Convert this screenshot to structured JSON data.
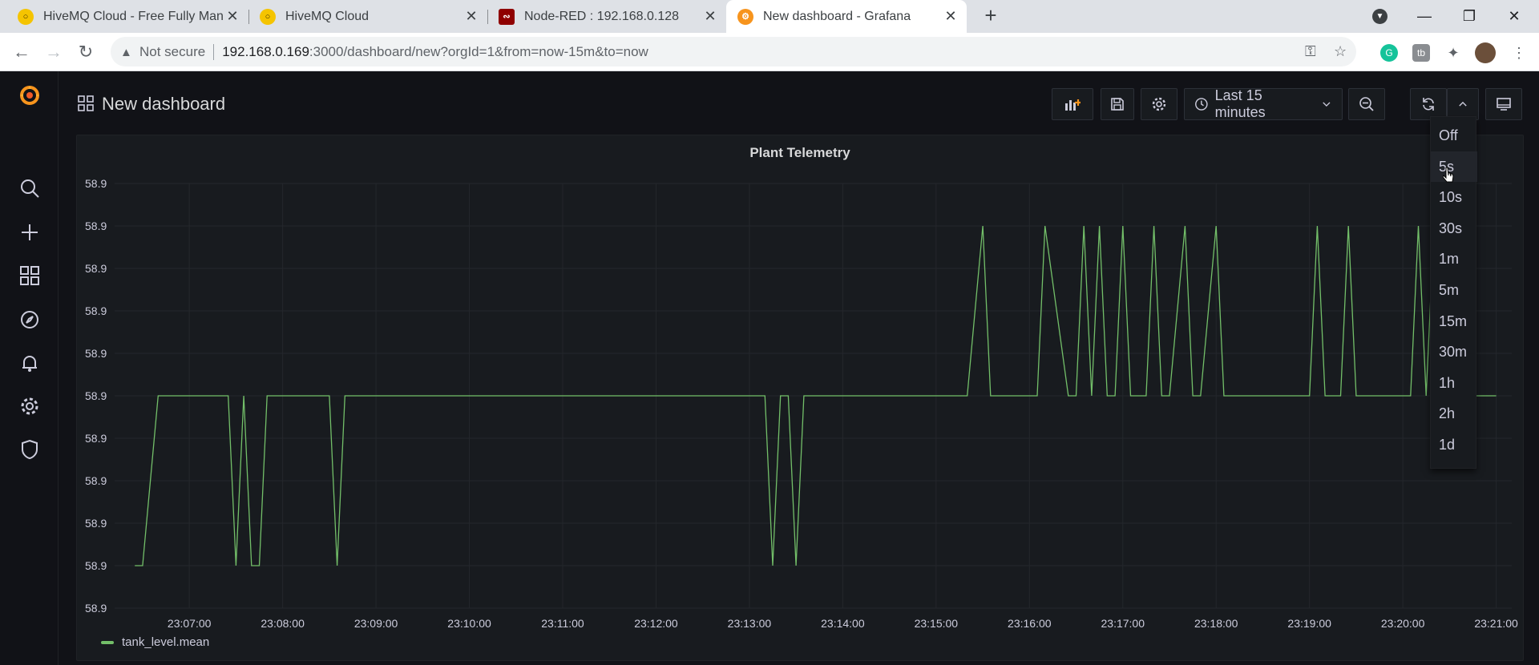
{
  "browser": {
    "tabs": [
      {
        "title": "HiveMQ Cloud - Free Fully Mana",
        "icon": "hivemq-icon"
      },
      {
        "title": "HiveMQ Cloud",
        "icon": "hivemq-icon"
      },
      {
        "title": "Node-RED : 192.168.0.128",
        "icon": "node-red-icon"
      },
      {
        "title": "New dashboard - Grafana",
        "icon": "grafana-icon",
        "active": true
      }
    ],
    "address": {
      "security_label": "Not secure",
      "host": "192.168.0.169",
      "path": ":3000/dashboard/new?orgId=1&from=now-15m&to=now"
    }
  },
  "grafana": {
    "dashboard_title": "New dashboard",
    "time_range_label": "Last 15 minutes",
    "panel": {
      "title": "Plant Telemetry",
      "legend_label": "tank_level.mean"
    },
    "refresh_options": [
      "Off",
      "5s",
      "10s",
      "30s",
      "1m",
      "5m",
      "15m",
      "30m",
      "1h",
      "2h",
      "1d"
    ],
    "hovered_refresh_option": "5s"
  },
  "colors": {
    "series": "#73bf69",
    "background": "#111217",
    "panel": "#181b1f"
  },
  "chart_data": {
    "type": "line",
    "title": "Plant Telemetry",
    "xlabel": "",
    "ylabel": "",
    "y_tick_labels": [
      "58.9",
      "58.9",
      "58.9",
      "58.9",
      "58.9",
      "58.9",
      "58.9",
      "58.9",
      "58.9",
      "58.9",
      "58.9"
    ],
    "x_tick_labels": [
      "23:07:00",
      "23:08:00",
      "23:09:00",
      "23:10:00",
      "23:11:00",
      "23:12:00",
      "23:13:00",
      "23:14:00",
      "23:15:00",
      "23:16:00",
      "23:17:00",
      "23:18:00",
      "23:19:00",
      "23:20:00",
      "23:21:00"
    ],
    "grid": true,
    "legend_placement": "bottom-left",
    "series": [
      {
        "name": "tank_level.mean",
        "level_note": "values shown relative to tick rows: all ticks read 58.9",
        "x": [
          "23:06:25",
          "23:06:30",
          "23:06:40",
          "23:07:25",
          "23:07:30",
          "23:07:35",
          "23:07:40",
          "23:07:45",
          "23:07:50",
          "23:07:55",
          "23:08:30",
          "23:08:35",
          "23:08:40",
          "23:13:10",
          "23:13:15",
          "23:13:20",
          "23:13:25",
          "23:13:30",
          "23:13:35",
          "23:13:40",
          "23:15:20",
          "23:15:30",
          "23:15:35",
          "23:16:05",
          "23:16:10",
          "23:16:25",
          "23:16:30",
          "23:16:35",
          "23:16:40",
          "23:16:45",
          "23:16:50",
          "23:16:55",
          "23:17:00",
          "23:17:05",
          "23:17:15",
          "23:17:20",
          "23:17:25",
          "23:17:30",
          "23:17:40",
          "23:17:45",
          "23:17:50",
          "23:18:00",
          "23:18:05",
          "23:18:10",
          "23:19:00",
          "23:19:05",
          "23:19:10",
          "23:19:20",
          "23:19:25",
          "23:19:30",
          "23:20:05",
          "23:20:10",
          "23:20:15",
          "23:20:20",
          "23:20:25",
          "23:20:30",
          "23:21:00"
        ],
        "y": [
          0,
          0,
          2,
          2,
          0,
          2,
          0,
          0,
          2,
          2,
          2,
          0,
          2,
          2,
          0,
          2,
          2,
          0,
          2,
          2,
          2,
          4,
          2,
          2,
          4,
          2,
          2,
          4,
          2,
          4,
          2,
          2,
          4,
          2,
          2,
          4,
          2,
          2,
          4,
          2,
          2,
          4,
          2,
          2,
          2,
          4,
          2,
          2,
          4,
          2,
          2,
          4,
          2,
          4,
          2,
          2,
          2
        ]
      }
    ]
  }
}
